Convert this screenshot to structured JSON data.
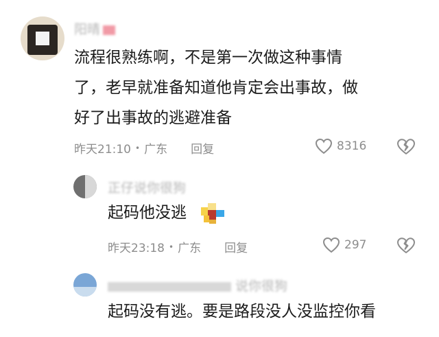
{
  "comments": [
    {
      "username": "阳晴",
      "lines": [
        "流程很熟练啊，不是第一次做这种事情",
        "了，老早就准备知道他肯定会出事故，做",
        "好了出事故的逃避准备"
      ],
      "time": "昨天21:10",
      "location": "广东",
      "reply_label": "回复",
      "likes": "8316"
    },
    {
      "username": "正仔说你很狗",
      "lines": [
        "起码他没逃"
      ],
      "time": "昨天23:18",
      "location": "广东",
      "reply_label": "回复",
      "likes": "297"
    },
    {
      "username": "说你很狗",
      "lines": [
        "起码没有逃。要是路段没人没监控你看"
      ]
    }
  ],
  "separator": "•",
  "icons": {
    "like": "heart-outline-icon",
    "dislike": "broken-heart-icon",
    "emoji": "pixelated-emoji-icon"
  },
  "colors": {
    "text": "#1b1b1b",
    "meta": "#8d8d8d",
    "blurred_name": "#b5b5b5"
  }
}
